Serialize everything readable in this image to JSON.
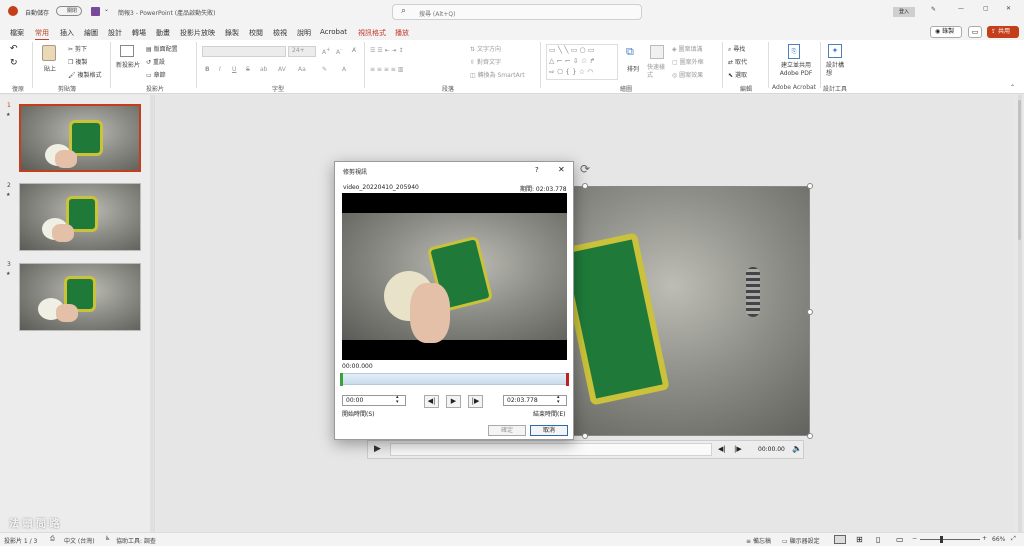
{
  "titlebar": {
    "autosave": "自動儲存",
    "autosave_state": "關閉",
    "doc_title": "簡報3 - PowerPoint (產品啟動失敗)",
    "search_placeholder": "搜尋 (Alt+Q)",
    "user": "登入"
  },
  "tabs": [
    "檔案",
    "常用",
    "插入",
    "繪圖",
    "設計",
    "轉場",
    "動畫",
    "投影片放映",
    "錄製",
    "校閱",
    "檢視",
    "說明",
    "Acrobat",
    "視訊格式",
    "播放"
  ],
  "actions": {
    "record": "錄製",
    "share": "共用"
  },
  "ribbon": {
    "undo_group": "復原",
    "clipboard": {
      "paste": "貼上",
      "cut": "剪下",
      "copy": "複製",
      "format_painter": "複製格式",
      "label": "剪貼簿"
    },
    "slides": {
      "new_slide": "新投影片",
      "layout": "版面配置",
      "reset": "重設",
      "section": "章節",
      "label": "投影片"
    },
    "font": {
      "size": "24+",
      "label": "字型"
    },
    "paragraph": {
      "text_direction": "文字方向",
      "align_text": "對齊文字",
      "smartart": "轉換為 SmartArt",
      "label": "段落"
    },
    "drawing": {
      "arrange": "排列",
      "quick_styles": "快速樣式",
      "shape_fill": "圖案填滿",
      "shape_outline": "圖案外框",
      "shape_effects": "圖案效果",
      "label": "繪圖"
    },
    "editing": {
      "find": "尋找",
      "replace": "取代",
      "select": "選取",
      "label": "編輯"
    },
    "acrobat": {
      "create_pdf": "建立並共用 Adobe PDF",
      "label": "Adobe Acrobat"
    },
    "designer": {
      "design_ideas": "設計構想",
      "label": "設計工具"
    }
  },
  "slides": [
    {
      "num": "1",
      "star": "★"
    },
    {
      "num": "2",
      "star": "★"
    },
    {
      "num": "3",
      "star": "★"
    }
  ],
  "player": {
    "time": "00:00.00"
  },
  "dialog": {
    "title": "修剪視訊",
    "help": "?",
    "close": "✕",
    "filename": "video_20220410_205940",
    "duration": "期間: 02:03.778",
    "current_time": "00:00.000",
    "start_value": "00:00",
    "start_label": "開始時間(S)",
    "end_value": "02:03.778",
    "end_label": "結束時間(E)",
    "ok": "確定",
    "cancel": "取消"
  },
  "watermark": "法 頭 問 路",
  "status": {
    "slide": "投影片 1 / 3",
    "language": "中文 (台灣)",
    "accessibility": "協助工具: 調查",
    "notes": "備忘稿",
    "display": "顯示器設定",
    "zoom": "66%"
  },
  "colors": {
    "accent": "#b7472a",
    "selected_border": "#c43e1c",
    "share_bg": "#c43e1c"
  }
}
